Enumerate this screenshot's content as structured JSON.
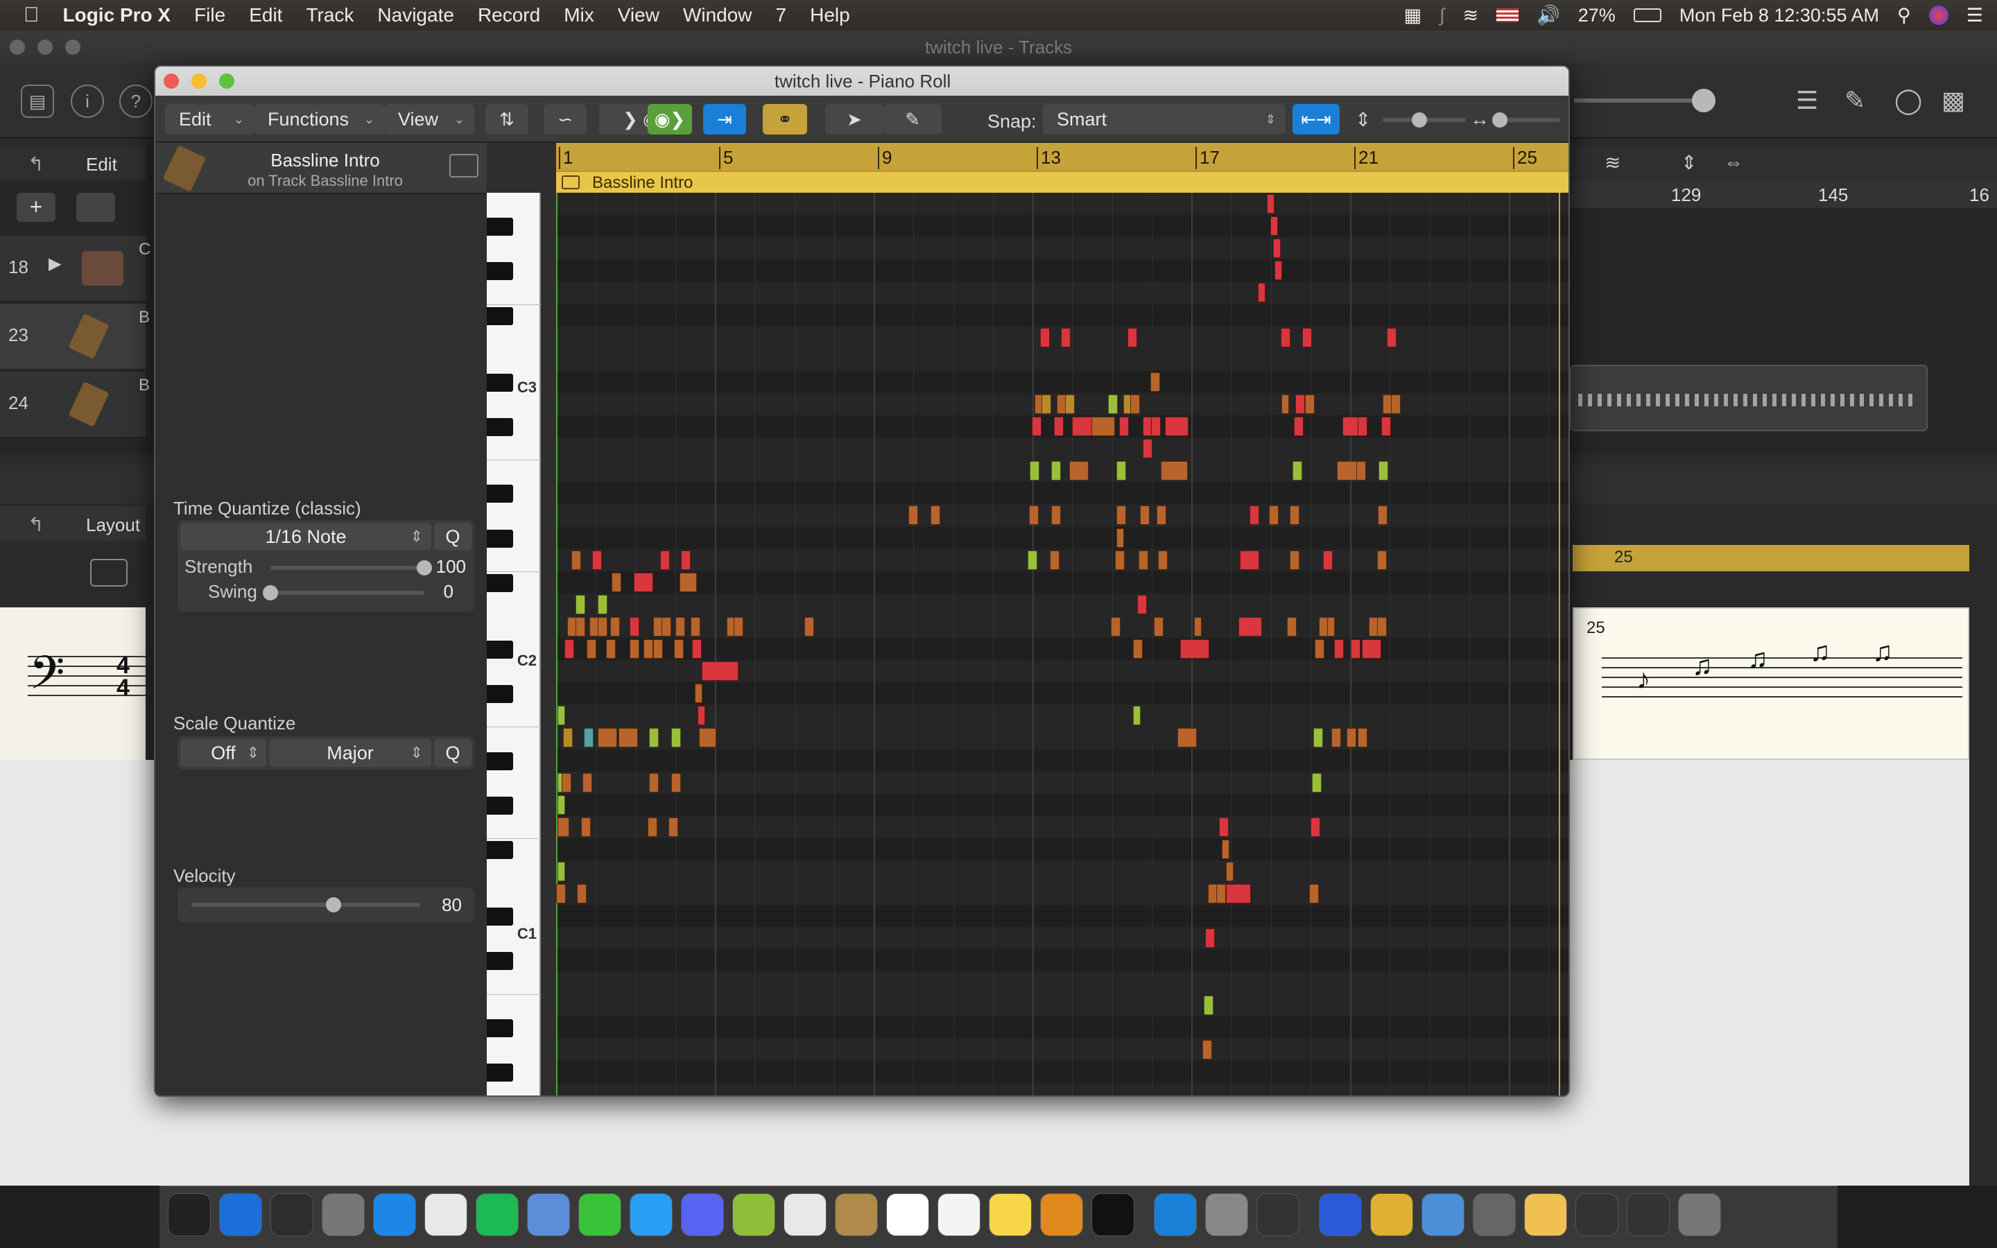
{
  "menubar": {
    "app": "Logic Pro X",
    "items": [
      "File",
      "Edit",
      "Track",
      "Navigate",
      "Record",
      "Mix",
      "View",
      "Window",
      "7",
      "Help"
    ],
    "battery": "27%",
    "clock": "Mon Feb 8  12:30:55 AM"
  },
  "tracks_window": {
    "title": "twitch live - Tracks",
    "edit_label": "Edit",
    "track_numbers": [
      "18",
      "23",
      "24"
    ],
    "track_letters": [
      "C",
      "B",
      "B"
    ],
    "ruler_numbers": [
      "129",
      "145",
      "16"
    ],
    "layout_label": "Layout",
    "score_bar": "25"
  },
  "piano_roll": {
    "title": "twitch live - Piano Roll",
    "menus": [
      "Edit",
      "Functions",
      "View"
    ],
    "snap_label": "Snap:",
    "snap_value": "Smart",
    "region_name": "Bassline Intro",
    "region_subtitle": "on Track Bassline Intro",
    "ruler_marks": [
      "1",
      "5",
      "9",
      "13",
      "17",
      "21",
      "25"
    ],
    "octave_labels": [
      "C3",
      "C2",
      "C1"
    ]
  },
  "inspector": {
    "time_quantize_title": "Time Quantize (classic)",
    "time_quantize_value": "1/16 Note",
    "q_label": "Q",
    "strength_label": "Strength",
    "strength_value": "100",
    "strength_fraction": 1.0,
    "swing_label": "Swing",
    "swing_value": "0",
    "swing_fraction": 0.0,
    "scale_quantize_title": "Scale Quantize",
    "scale_off": "Off",
    "scale_mode": "Major",
    "velocity_title": "Velocity",
    "velocity_value": "80",
    "velocity_fraction": 0.62
  },
  "colors": {
    "accent_blue": "#1a7fd6",
    "region_yellow": "#e8c64a",
    "note_red": "#d9363e",
    "note_orange": "#c9732e",
    "note_green": "#9bbf3a"
  }
}
